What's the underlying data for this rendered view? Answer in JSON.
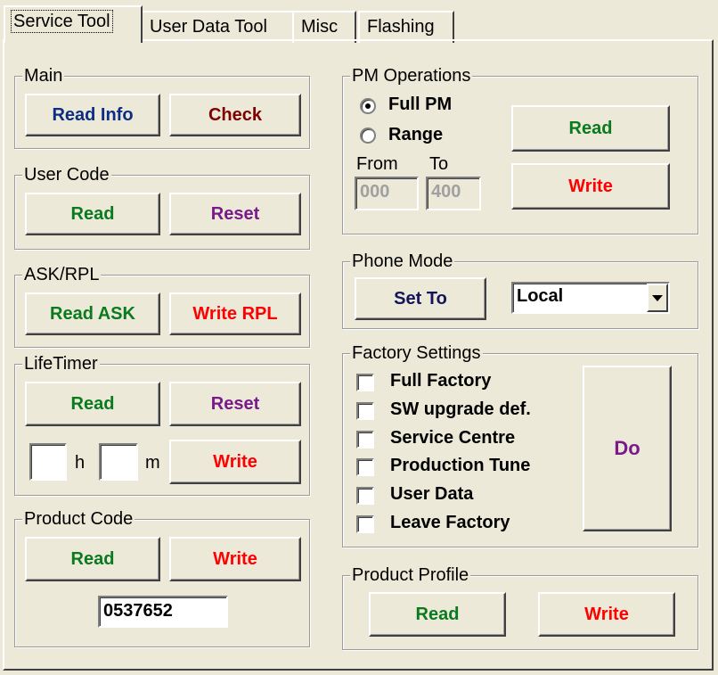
{
  "tabs": [
    "Service Tool",
    "User Data Tool",
    "Misc",
    "Flashing"
  ],
  "main": {
    "label": "Main",
    "read_info": "Read Info",
    "check": "Check"
  },
  "user_code": {
    "label": "User Code",
    "read": "Read",
    "reset": "Reset"
  },
  "ask_rpl": {
    "label": "ASK/RPL",
    "read_ask": "Read ASK",
    "write_rpl": "Write RPL"
  },
  "lifetimer": {
    "label": "LifeTimer",
    "read": "Read",
    "reset": "Reset",
    "hours_value": "",
    "hours_unit": "h",
    "minutes_value": "",
    "minutes_unit": "m",
    "write": "Write"
  },
  "product_code": {
    "label": "Product Code",
    "read": "Read",
    "write": "Write",
    "value": "0537652"
  },
  "pm_operations": {
    "label": "PM Operations",
    "options": [
      "Full PM",
      "Range"
    ],
    "selected": "Full PM",
    "from_label": "From",
    "to_label": "To",
    "from_value": "000",
    "to_value": "400",
    "read": "Read",
    "write": "Write"
  },
  "phone_mode": {
    "label": "Phone Mode",
    "set_to": "Set To",
    "selected": "Local"
  },
  "factory_settings": {
    "label": "Factory Settings",
    "items": [
      "Full Factory",
      "SW upgrade def.",
      "Service Centre",
      "Production Tune",
      "User Data",
      "Leave Factory"
    ],
    "do": "Do"
  },
  "product_profile": {
    "label": "Product Profile",
    "read": "Read",
    "write": "Write"
  },
  "colors": {
    "background": "#ece9d8",
    "blue": "#0c2d83",
    "maroon": "#800000",
    "green": "#0a7a1e",
    "purple": "#7a1a8a",
    "red": "#ff0000"
  },
  "icons": {
    "combo_arrow": "triangle-down-icon",
    "radio_selected": "radio-dot-icon"
  }
}
